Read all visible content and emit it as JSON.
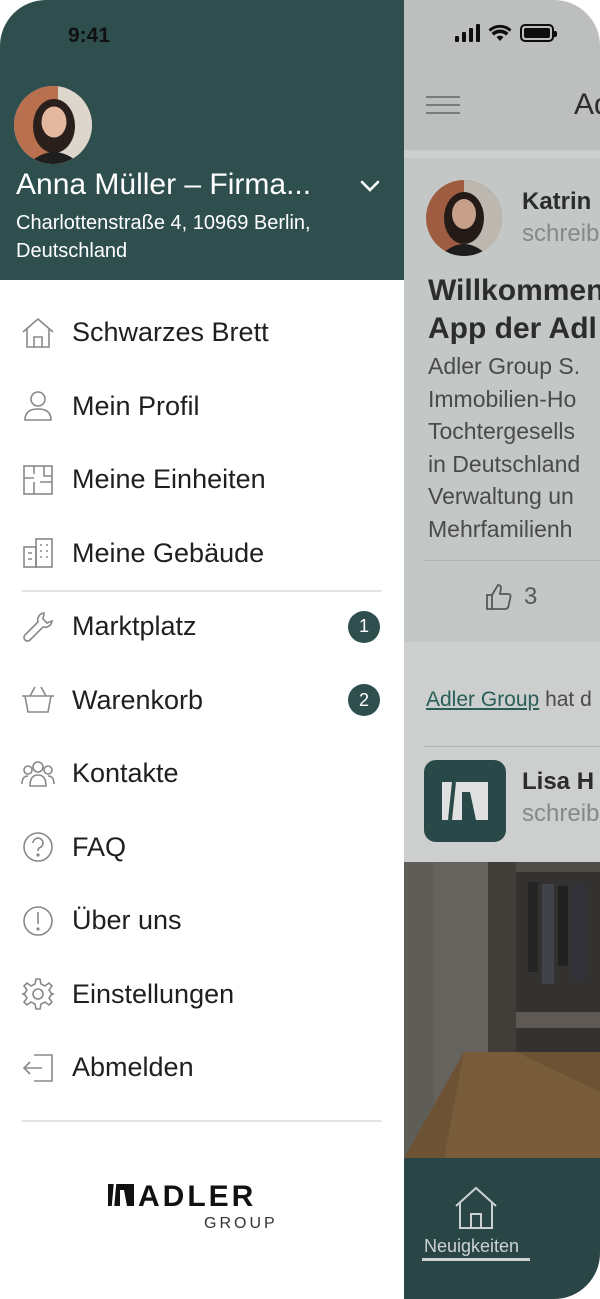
{
  "status_bar": {
    "time": "9:41"
  },
  "user": {
    "name": "Anna Müller – Firma...",
    "address": "Charlottenstraße 4, 10969 Berlin, Deutschland"
  },
  "menu": [
    {
      "label": "Schwarzes Brett",
      "icon": "home-icon"
    },
    {
      "label": "Mein Profil",
      "icon": "person-icon"
    },
    {
      "label": "Meine Einheiten",
      "icon": "floorplan-icon"
    },
    {
      "label": "Meine Gebäude",
      "icon": "building-icon"
    },
    {
      "label": "Marktplatz",
      "icon": "tools-icon",
      "badge": "1"
    },
    {
      "label": "Warenkorb",
      "icon": "basket-icon",
      "badge": "2"
    },
    {
      "label": "Kontakte",
      "icon": "contacts-icon"
    },
    {
      "label": "FAQ",
      "icon": "question-icon"
    },
    {
      "label": "Über uns",
      "icon": "info-icon"
    },
    {
      "label": "Einstellungen",
      "icon": "gear-icon"
    },
    {
      "label": "Abmelden",
      "icon": "logout-icon"
    }
  ],
  "brand": {
    "logo_text": "ADLER",
    "logo_subtext": "GROUP",
    "primary_color": "#2f4f4f"
  },
  "background_app": {
    "title": "Ad",
    "post": {
      "author": "Katrin",
      "subtitle": "schreib",
      "headline": "Willkommen\nApp der Adl",
      "body": "Adler Group S.\nImmobilien-Ho\nTochtergesells\nin Deutschland\nVerwaltung un\nMehrfamilienh",
      "likes": "3"
    },
    "shared": {
      "link": "Adler Group",
      "text": " hat d"
    },
    "post2": {
      "author": "Lisa H",
      "subtitle": "schreib"
    },
    "bottom_nav": {
      "label": "Neuigkeiten"
    }
  }
}
